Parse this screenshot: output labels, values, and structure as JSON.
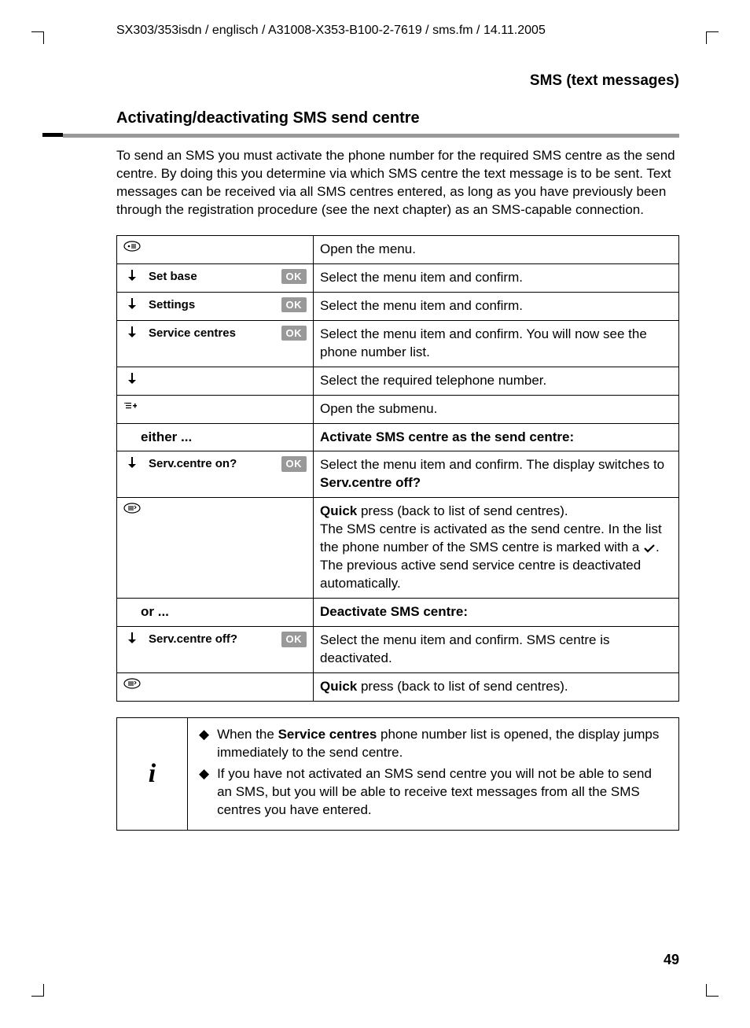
{
  "header_path": "SX303/353isdn / englisch / A31008-X353-B100-2-7619 / sms.fm / 14.11.2005",
  "section_title": "SMS (text messages)",
  "subheading": "Activating/deactivating SMS send centre",
  "intro": "To send an SMS you must activate the phone number for the required SMS centre as the send centre. By doing this you determine via which SMS centre the text message is to be sent. Text messages can be received via all SMS centres entered, as long as you have previously been through the registration procedure (see the next chapter) as an SMS-capable connection.",
  "ok": "OK",
  "rows": {
    "r0_desc": "Open the menu.",
    "r1_label": "Set base",
    "r1_desc": "Select the menu item and confirm.",
    "r2_label": "Settings",
    "r2_desc": "Select the menu item and confirm.",
    "r3_label": "Service centres",
    "r3_desc": "Select the menu item and confirm. You will now see the phone number list.",
    "r4_desc": "Select the required telephone number.",
    "r5_desc": "Open the submenu.",
    "either_label": "either ...",
    "either_head": "Activate SMS centre as the send centre:",
    "r6_label": "Serv.centre on?",
    "r6_desc_a": "Select the menu item and confirm. The display switches to ",
    "r6_desc_b": "Serv.centre off?",
    "r7_desc_a": "Quick",
    "r7_desc_b": " press (back to list of send centres).",
    "r7_desc_c": "The SMS centre is activated as the send centre. In the list the phone number of the SMS centre is marked with a ",
    "r7_desc_d": ". The previous active send service centre is deactivated automatically.",
    "or_label": "or ...",
    "or_head": "Deactivate SMS centre:",
    "r8_label": "Serv.centre off?",
    "r8_desc": "Select the menu item and confirm. SMS centre is deactivated.",
    "r9_desc_a": "Quick",
    "r9_desc_b": " press (back to list of send centres)."
  },
  "info": {
    "icon": "i",
    "b1_a": "When the ",
    "b1_b": "Service centres",
    "b1_c": " phone number list is opened, the display jumps immediately to the send centre.",
    "b2": "If you have not activated an SMS send centre you will not be able to send an SMS, but you will be able to receive text messages from all the SMS centres you have entered."
  },
  "page_number": "49"
}
